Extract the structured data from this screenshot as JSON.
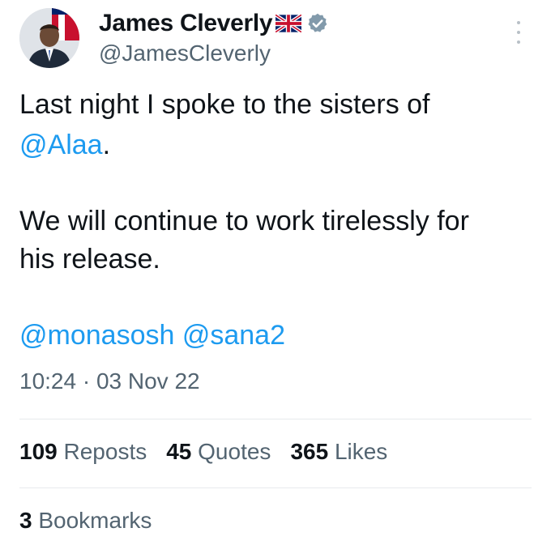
{
  "author": {
    "display_name": "James Cleverly",
    "handle": "@JamesCleverly",
    "flag_emoji": "united-kingdom-flag-icon",
    "verified_icon": "verified-badge-icon"
  },
  "tweet": {
    "line1": "Last night I spoke to the sisters of",
    "line2_mention": "@Alaa",
    "line2_after": ".",
    "line3": "We will continue to work tirelessly for",
    "line4": "his release.",
    "mention1": "@monasosh",
    "mention2": "@sana2"
  },
  "timestamp": {
    "time": "10:24",
    "separator": "·",
    "date": "03 Nov 22"
  },
  "stats": {
    "reposts_count": "109",
    "reposts_label": "Reposts",
    "quotes_count": "45",
    "quotes_label": "Quotes",
    "likes_count": "365",
    "likes_label": "Likes",
    "bookmarks_count": "3",
    "bookmarks_label": "Bookmarks"
  },
  "colors": {
    "link": "#1d9bf0",
    "secondary_text": "#536471",
    "primary_text": "#0f1419",
    "verified": "#829aab"
  }
}
